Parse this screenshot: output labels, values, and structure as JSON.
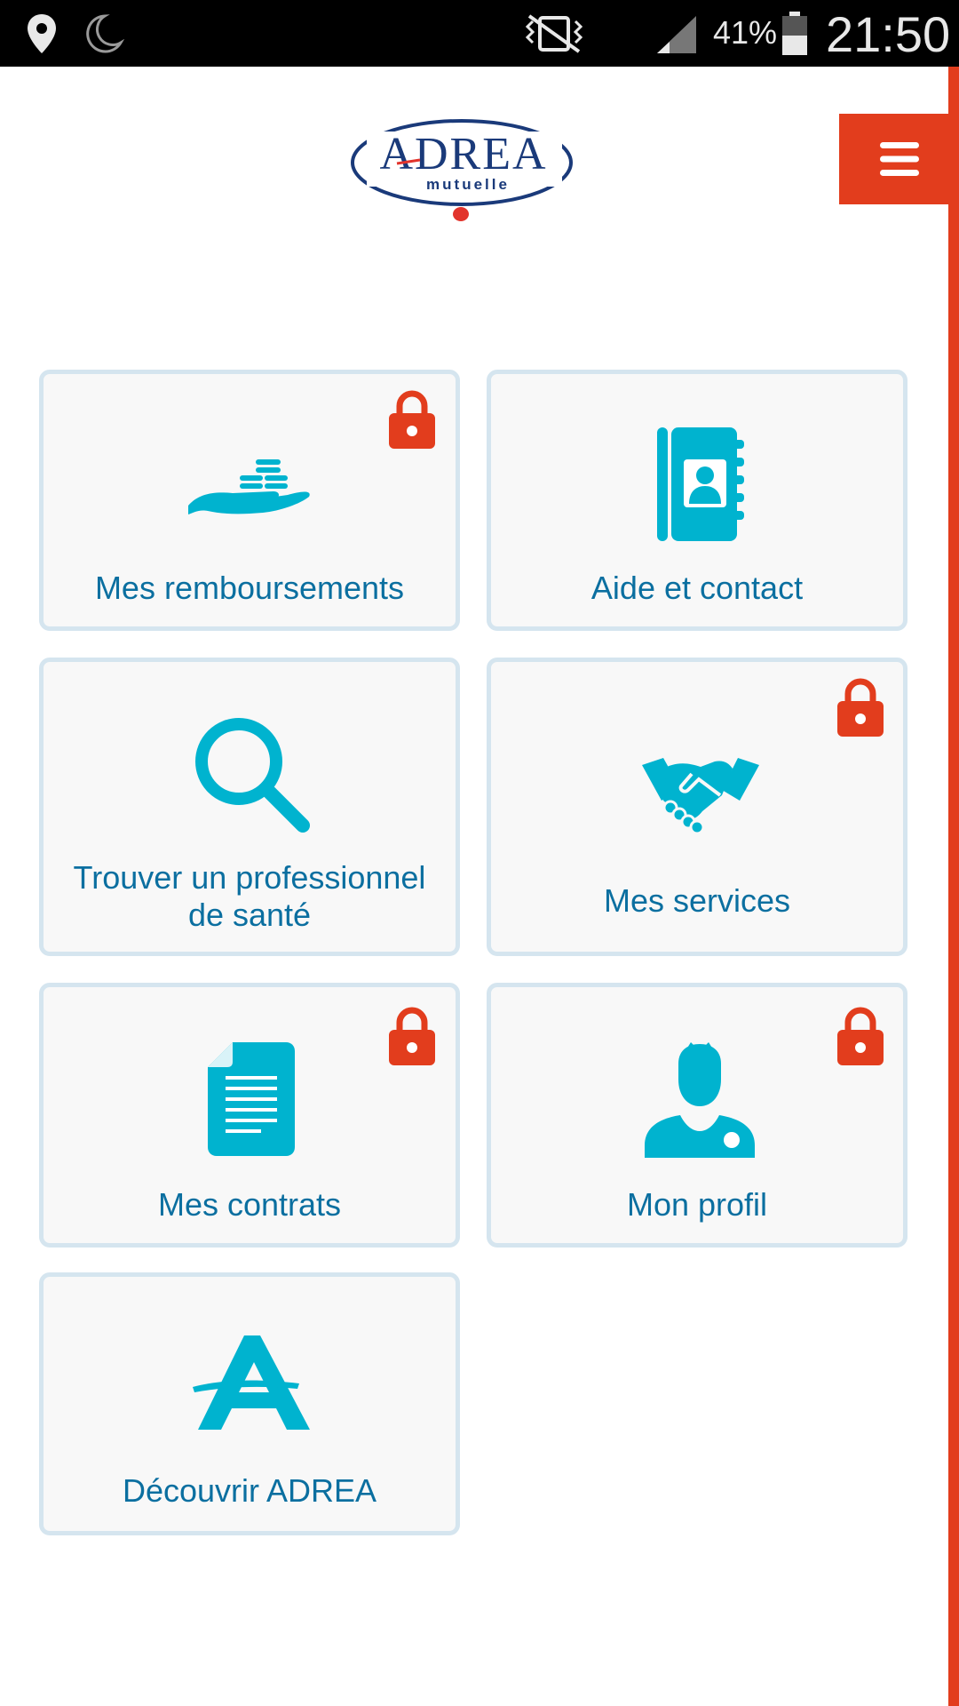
{
  "status_bar": {
    "battery_percent": "41%",
    "time": "21:50"
  },
  "header": {
    "logo_text": "ADREA",
    "logo_subtext": "mutuelle",
    "menu_icon": "hamburger-menu-icon"
  },
  "colors": {
    "accent_red": "#e23d1d",
    "icon_cyan": "#00b3cf",
    "label_blue": "#0b6fa0",
    "tile_border": "#d5e5ef",
    "logo_navy": "#1a3a7a"
  },
  "tiles": [
    {
      "label": "Mes remboursements",
      "icon": "hand-coins-icon",
      "locked": true
    },
    {
      "label": "Aide et contact",
      "icon": "address-book-icon",
      "locked": false
    },
    {
      "label_line1": "Trouver un professionnel",
      "label_line2": "de santé",
      "icon": "magnifier-icon",
      "locked": false
    },
    {
      "label": "Mes services",
      "icon": "handshake-icon",
      "locked": true
    },
    {
      "label": "Mes contrats",
      "icon": "document-icon",
      "locked": true
    },
    {
      "label": "Mon profil",
      "icon": "user-icon",
      "locked": true
    },
    {
      "label": "Découvrir ADREA",
      "icon": "adrea-a-icon",
      "locked": false
    }
  ]
}
